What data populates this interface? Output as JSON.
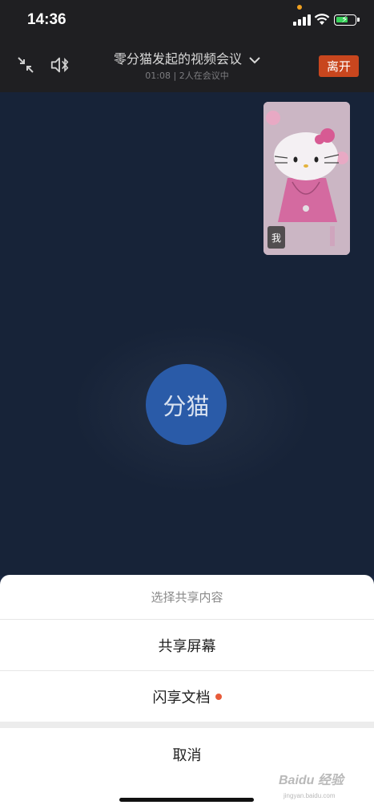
{
  "status_bar": {
    "time": "14:36",
    "icons": [
      "signal-icon",
      "wifi-icon",
      "battery-charging-icon"
    ]
  },
  "toolbar": {
    "minimize_icon": "collapse-arrows-icon",
    "audio_icon": "speaker-bluetooth-icon",
    "title": "零分猫发起的视频会议",
    "subtitle": "01:08  |  2人在会议中",
    "leave_label": "离开"
  },
  "video": {
    "participant_avatar_text": "分猫",
    "self_tile_label": "我",
    "avatar_color": "#2a5ba8"
  },
  "share_sheet": {
    "title": "选择共享内容",
    "options": [
      {
        "label": "共享屏幕"
      },
      {
        "label": "闪享文档"
      }
    ],
    "cancel_label": "取消"
  },
  "watermark": {
    "brand": "Baidu 经验",
    "url": "jingyan.baidu.com"
  },
  "colors": {
    "accent_leave": "#c8461e",
    "badge_dot": "#e85b3a"
  }
}
